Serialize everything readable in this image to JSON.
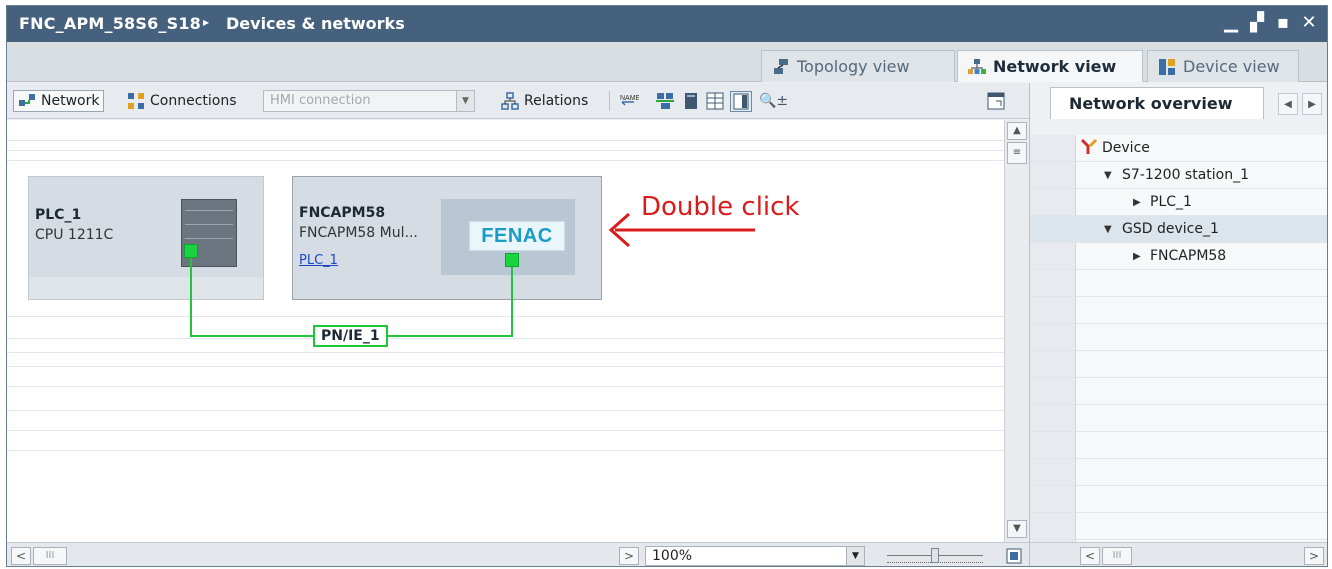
{
  "window": {
    "title": "FNC_APM_58S6_S18",
    "separator": "▸",
    "breadcrumb": "Devices & networks",
    "controls": [
      "▁",
      "▞",
      "▪",
      "✕"
    ]
  },
  "view_tabs": [
    {
      "label": "Topology view",
      "icon": "topology-icon",
      "active": false
    },
    {
      "label": "Network view",
      "icon": "network-icon",
      "active": true
    },
    {
      "label": "Device view",
      "icon": "device-icon",
      "active": false
    }
  ],
  "toolbar": {
    "network_label": "Network",
    "connections_label": "Connections",
    "connection_type_placeholder": "HMI connection",
    "relations_label": "Relations",
    "zoom_in_symbol": "🔍±"
  },
  "canvas": {
    "devices": [
      {
        "name": "PLC_1",
        "type": "CPU 1211C"
      },
      {
        "name": "FNCAPM58",
        "type": "FNCAPM58 Mul...",
        "link": "PLC_1",
        "logo_text": "FENAC"
      }
    ],
    "subnet_label": "PN/IE_1",
    "annotation": "Double click"
  },
  "bottom": {
    "zoom_value": "100%",
    "scroll_left": "<",
    "scroll_right": ">",
    "thumb": "III"
  },
  "overview": {
    "tab_label": "Network overview",
    "column_header": "Device",
    "rows": [
      {
        "label": "S7-1200 station_1",
        "expanded": true,
        "indent": 1
      },
      {
        "label": "PLC_1",
        "expanded": false,
        "indent": 2
      },
      {
        "label": "GSD device_1",
        "expanded": true,
        "indent": 1
      },
      {
        "label": "FNCAPM58",
        "expanded": false,
        "indent": 2
      }
    ]
  },
  "colors": {
    "titlebar": "#45617e",
    "port": "#19d43f",
    "subnet": "#23c43a",
    "annotation": "#d81c1c",
    "link": "#1b47c9"
  }
}
